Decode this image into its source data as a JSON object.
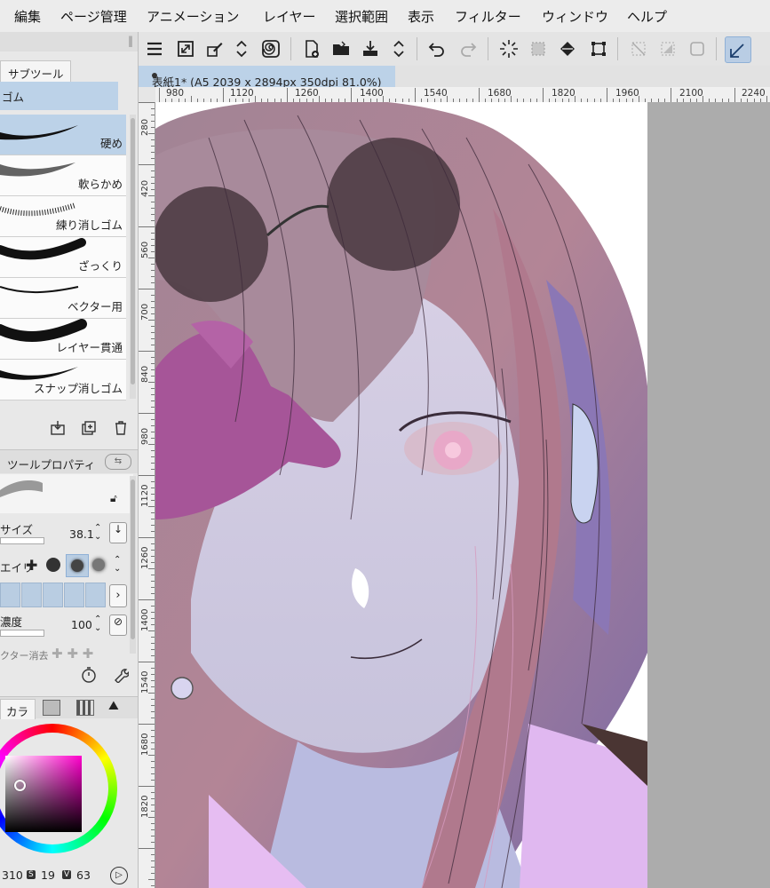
{
  "menu": [
    "編集",
    "ページ管理",
    "アニメーション",
    "レイヤー",
    "選択範囲",
    "表示",
    "フィルター",
    "ウィンドウ",
    "ヘルプ"
  ],
  "toolbar": {
    "icons": [
      "menu-icon",
      "resize-icon",
      "brush-settings-icon",
      "up-down-icon",
      "spiral-icon",
      "new-page-icon",
      "open-folder-icon",
      "export-icon",
      "up-down-icon",
      "undo-icon",
      "redo-icon",
      "burst-icon",
      "selection-icon",
      "fill-icon",
      "transform-icon",
      "deselect-icon",
      "invert-selection-icon",
      "crop-icon",
      "vector-pen-icon"
    ]
  },
  "document_tab": {
    "title": "表紙1* (A5 2039 x 2894px 350dpi 81.0%)"
  },
  "ruler": {
    "h_labels": [
      "980",
      "1120",
      "1260",
      "1400",
      "1540",
      "1680",
      "1820",
      "1960",
      "2100",
      "2240"
    ],
    "v_labels": [
      "280",
      "420",
      "560",
      "700",
      "840",
      "980",
      "1120",
      "1260",
      "1400",
      "1540",
      "1680",
      "1820"
    ]
  },
  "left_panel": {
    "subtool_tab": "サブツール",
    "tool_name": "ゴム",
    "brushes": [
      "硬め",
      "軟らかめ",
      "練り消しゴム",
      "ざっくり",
      "ベクター用",
      "レイヤー貫通",
      "スナップ消しゴム"
    ],
    "tool_property_tab": "ツールプロパティ",
    "brush_size_label": "サイズ",
    "brush_size_value": "38.1",
    "shape_label": "エイリ",
    "density_label": "濃度",
    "density_value": "100",
    "vector_erase_label": "クター消去",
    "color_tab": "カラ",
    "status": {
      "h": "310",
      "s_badge": "S",
      "s": "19",
      "v_badge": "V",
      "v": "63"
    }
  },
  "colors": {
    "accent": "#bcd2e8",
    "current_color": "#f5a4d6"
  }
}
